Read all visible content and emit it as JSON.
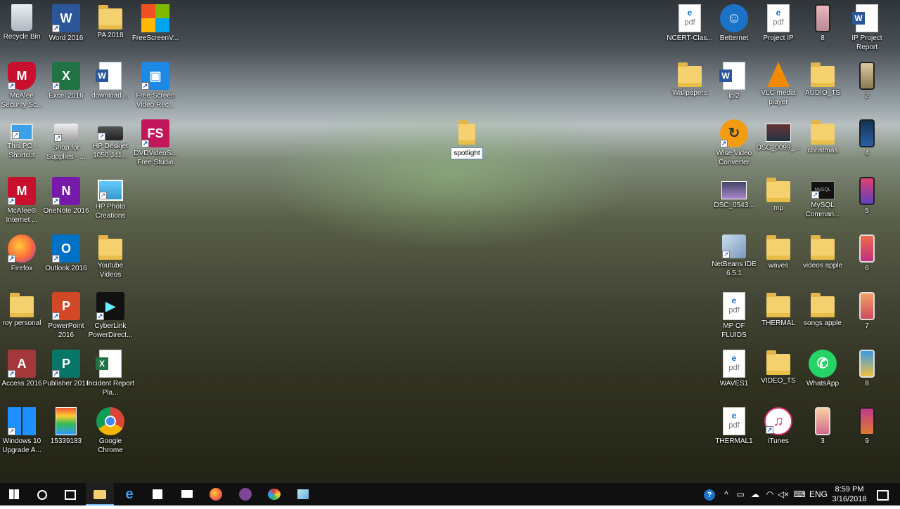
{
  "desktop": {
    "left_col1": [
      "Recycle Bin",
      "McAfee Security Sc...",
      "This PC - Shortcut",
      "McAfee® Internet ...",
      "Firefox",
      "roy personal",
      "Access 2016",
      "Windows 10 Upgrade A..."
    ],
    "left_col2": [
      "Word 2016",
      "Excel 2016",
      "Shop for Supplies - ...",
      "OneNote 2016",
      "Outlook 2016",
      "PowerPoint 2016",
      "Publisher 2016",
      "15339183"
    ],
    "left_col3": [
      "PA 2018",
      "download ...",
      "HP Deskjet 1050 J41...",
      "HP Photo Creations",
      "Youtube Videos",
      "CyberLink PowerDirect...",
      "Incident Report Pla...",
      "Google Chrome"
    ],
    "left_col4": [
      "FreeScreenV...",
      "Free Screen Video Rec...",
      "DVDVideoS... Free Studio"
    ],
    "center_folder": "spotlight",
    "right_top": [
      "NCERT-Clas...",
      "Betternet",
      "Project IP",
      "8",
      "IP Project Report"
    ],
    "right_row2": [
      "Wallpapers",
      "ipl2",
      "VLC media player",
      "AUDIO_TS",
      "2"
    ],
    "right_c1": [
      "Wise Video Converter",
      "DSC_0543...",
      "NetBeans IDE 6.5.1",
      "MP OF FLUIDS",
      "WAVES1",
      "THERMAL1"
    ],
    "right_c2": [
      "DSC_0099_...",
      "mp",
      "waves",
      "THERMAL",
      "VIDEO_TS",
      "iTunes"
    ],
    "right_c3": [
      "christmas",
      "MySQL Comman...",
      "videos apple",
      "songs apple",
      "WhatsApp",
      "3"
    ],
    "right_c4": [
      "4",
      "5",
      "6",
      "7",
      "8",
      "9"
    ]
  },
  "taskbar": {
    "tray_lang": "ENG",
    "time": "8:59 PM",
    "date": "3/16/2018"
  }
}
